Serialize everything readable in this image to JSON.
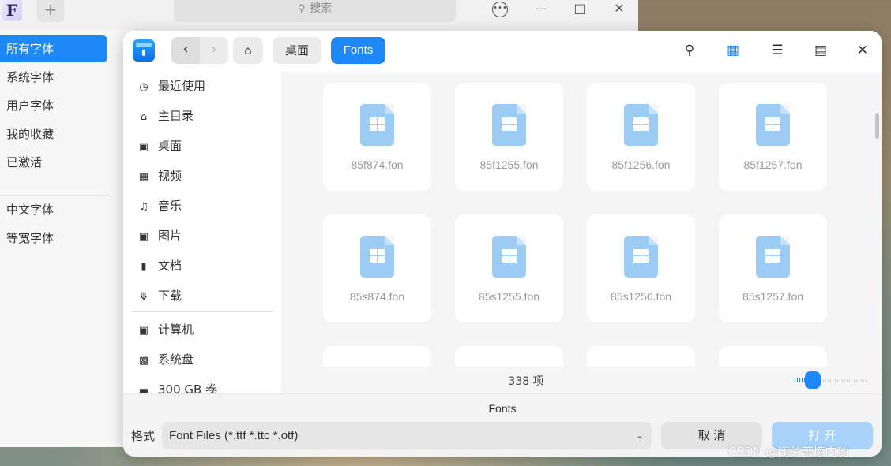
{
  "font_manager": {
    "logo_letter": "F",
    "add_label": "+",
    "search_placeholder": "搜索",
    "sidebar": [
      {
        "label": "所有字体",
        "active": true
      },
      {
        "label": "系统字体"
      },
      {
        "label": "用户字体"
      },
      {
        "label": "我的收藏"
      },
      {
        "label": "已激活"
      },
      {
        "label": "中文字体"
      },
      {
        "label": "等宽字体"
      }
    ]
  },
  "dialog": {
    "breadcrumbs": [
      "桌面",
      "Fonts"
    ],
    "sidebar": [
      {
        "label": "最近使用",
        "icon": "clock-icon"
      },
      {
        "label": "主目录",
        "icon": "home-icon"
      },
      {
        "label": "桌面",
        "icon": "desktop-icon"
      },
      {
        "label": "视频",
        "icon": "video-icon"
      },
      {
        "label": "音乐",
        "icon": "music-icon"
      },
      {
        "label": "图片",
        "icon": "picture-icon"
      },
      {
        "label": "文档",
        "icon": "document-icon"
      },
      {
        "label": "下载",
        "icon": "download-icon"
      },
      {
        "label": "计算机",
        "icon": "computer-icon"
      },
      {
        "label": "系统盘",
        "icon": "disk-icon"
      },
      {
        "label": "300 GB 卷",
        "icon": "volume-icon"
      }
    ],
    "files": [
      "85f874.fon",
      "85f1255.fon",
      "85f1256.fon",
      "85f1257.fon",
      "85s874.fon",
      "85s1255.fon",
      "85s1256.fon",
      "85s1257.fon"
    ],
    "item_count": "338 项",
    "zoom_level": 0.2,
    "current_folder": "Fonts",
    "filter_label": "格式",
    "filter_value": "Font Files (*.ttf *.ttc *.otf)",
    "cancel_label": "取 消",
    "open_label": "打 开"
  },
  "watermark": "CSDN @闭关苦炼内功",
  "colors": {
    "accent": "#1e88f7",
    "file_icon": "#9ccbf4"
  }
}
